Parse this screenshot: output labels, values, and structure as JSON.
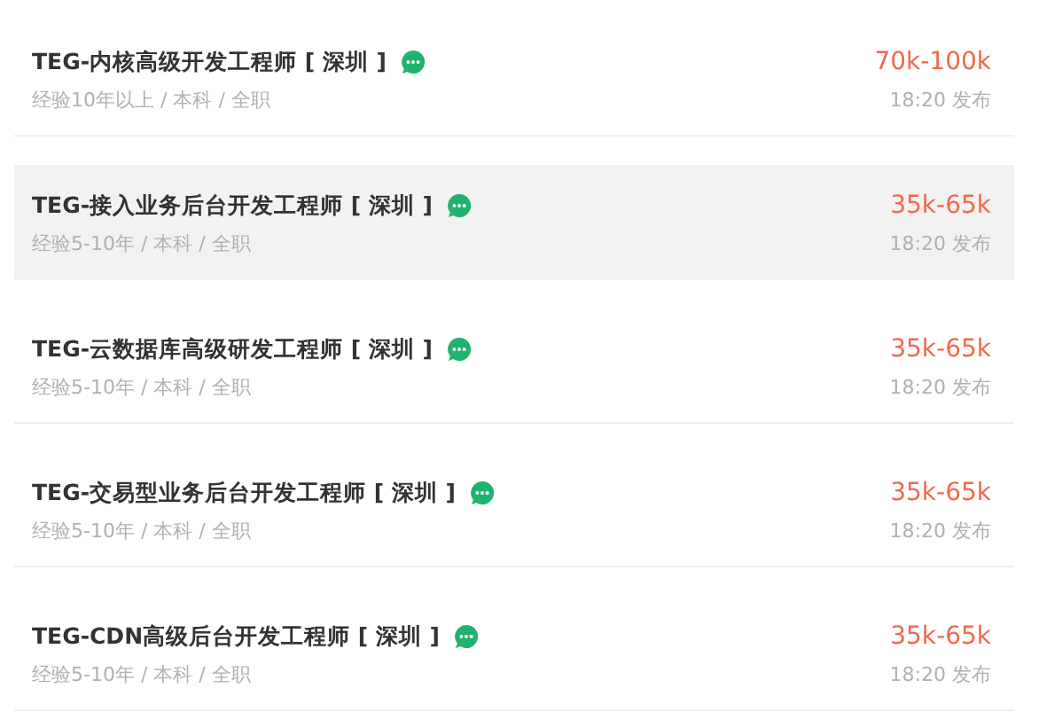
{
  "jobs": [
    {
      "title": "TEG-内核高级开发工程师 [ 深圳 ]",
      "meta": "经验10年以上 / 本科 / 全职",
      "salary": "70k-100k",
      "time": "18:20 发布",
      "selected": false
    },
    {
      "title": "TEG-接入业务后台开发工程师 [ 深圳 ]",
      "meta": "经验5-10年 / 本科 / 全职",
      "salary": "35k-65k",
      "time": "18:20 发布",
      "selected": true
    },
    {
      "title": "TEG-云数据库高级研发工程师 [ 深圳 ]",
      "meta": "经验5-10年 / 本科 / 全职",
      "salary": "35k-65k",
      "time": "18:20 发布",
      "selected": false
    },
    {
      "title": "TEG-交易型业务后台开发工程师 [ 深圳 ]",
      "meta": "经验5-10年 / 本科 / 全职",
      "salary": "35k-65k",
      "time": "18:20 发布",
      "selected": false
    },
    {
      "title": "TEG-CDN高级后台开发工程师 [ 深圳 ]",
      "meta": "经验5-10年 / 本科 / 全职",
      "salary": "35k-65k",
      "time": "18:20 发布",
      "selected": false
    }
  ]
}
